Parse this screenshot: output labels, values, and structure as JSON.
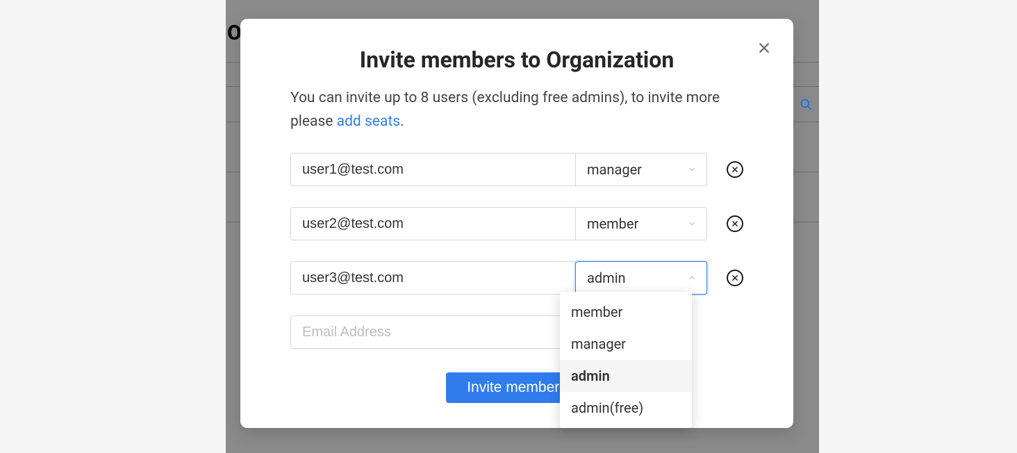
{
  "background": {
    "page_title_letter": "O"
  },
  "modal": {
    "title": "Invite members to Organization",
    "desc_prefix": "You can invite up to 8 users (excluding free admins), to invite more please ",
    "desc_link": "add seats",
    "desc_suffix": ".",
    "email_placeholder": "Email Address",
    "submit_label": "Invite members",
    "rows": [
      {
        "email": "user1@test.com",
        "role": "manager",
        "open": false,
        "badge": false
      },
      {
        "email": "user2@test.com",
        "role": "member",
        "open": false,
        "badge": false
      },
      {
        "email": "user3@test.com",
        "role": "admin",
        "open": true,
        "badge": true
      }
    ],
    "role_options": [
      {
        "label": "member",
        "selected": false
      },
      {
        "label": "manager",
        "selected": false
      },
      {
        "label": "admin",
        "selected": true
      },
      {
        "label": "admin(free)",
        "selected": false
      }
    ]
  }
}
